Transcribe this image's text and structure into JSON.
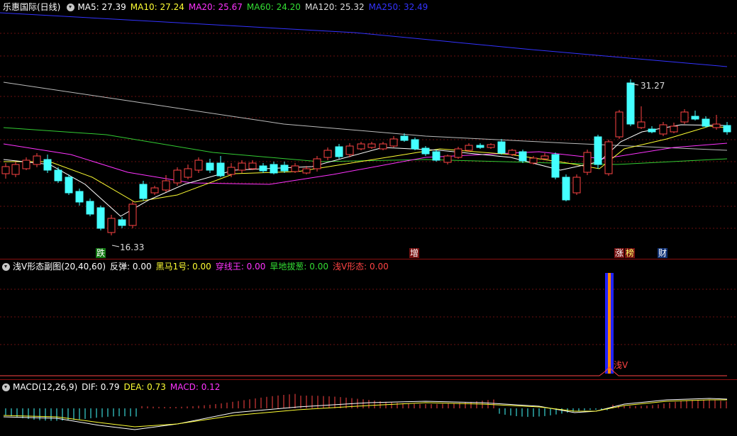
{
  "header": {
    "title": "乐惠国际(日线)",
    "ma": [
      {
        "label": "MA5: 27.39",
        "color": "#ffffff"
      },
      {
        "label": "MA10: 27.24",
        "color": "#ffff33"
      },
      {
        "label": "MA20: 25.67",
        "color": "#ff33ff"
      },
      {
        "label": "MA60: 24.20",
        "color": "#33dd33"
      },
      {
        "label": "MA120: 25.32",
        "color": "#dddddd"
      },
      {
        "label": "MA250: 32.49",
        "color": "#3333ff"
      }
    ]
  },
  "main": {
    "high_label": "31.27",
    "low_label": "16.33",
    "markers": [
      {
        "text": "跌",
        "color": "#ffffff",
        "bg": "#117711"
      },
      {
        "text": "增",
        "color": "#ffffff",
        "bg": "#771111"
      },
      {
        "text": "涨",
        "color": "#ffffff",
        "bg": "#771111"
      },
      {
        "text": "榜",
        "color": "#ffff66",
        "bg": "#771111"
      },
      {
        "text": "财",
        "color": "#ffffff",
        "bg": "#113377"
      }
    ]
  },
  "indicator": {
    "title": "浅V形态副图(20,40,60)",
    "items": [
      {
        "label": "反弹: 0.00",
        "color": "#ffffff"
      },
      {
        "label": "黑马1号: 0.00",
        "color": "#ffff33"
      },
      {
        "label": "穿线王: 0.00",
        "color": "#ff33ff"
      },
      {
        "label": "旱地拔葱: 0.00",
        "color": "#33dd33"
      },
      {
        "label": "浅V形态: 0.00",
        "color": "#ff4444"
      }
    ],
    "signal_label": "浅V"
  },
  "macd": {
    "title": "MACD(12,26,9)",
    "items": [
      {
        "label": "DIF: 0.79",
        "color": "#ffffff"
      },
      {
        "label": "DEA: 0.73",
        "color": "#ffff33"
      },
      {
        "label": "MACD: 0.12",
        "color": "#ff33ff"
      }
    ]
  }
}
